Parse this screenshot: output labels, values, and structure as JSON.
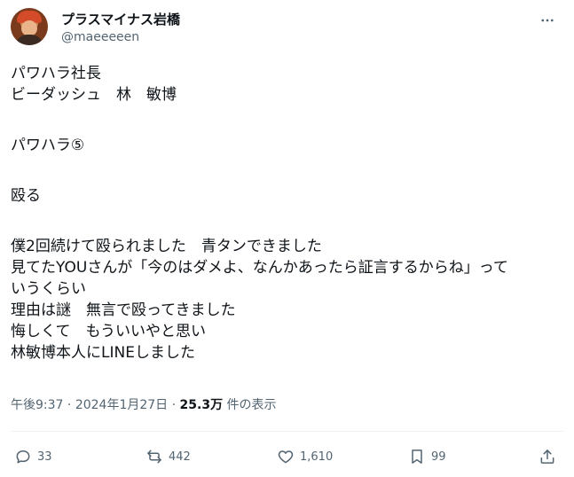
{
  "user": {
    "display_name": "プラスマイナス岩橋",
    "handle": "@maeeeeen"
  },
  "tweet": {
    "lines": [
      "パワハラ社長",
      "ビーダッシュ　林　敏博",
      "",
      "パワハラ⑤",
      "",
      "殴る",
      "",
      "僕2回続けて殴られました　青タンできました",
      "見てたYOUさんが「今のはダメよ、なんかあったら証言するからね」って",
      "いうくらい",
      "理由は謎　無言で殴ってきました",
      "悔しくて　もういいやと思い",
      "林敏博本人にLINEしました"
    ]
  },
  "meta": {
    "time": "午後9:37",
    "separator": "·",
    "date": "2024年1月27日",
    "views_count": "25.3万",
    "views_label": "件の表示"
  },
  "actions": {
    "reply_count": "33",
    "retweet_count": "442",
    "like_count": "1,610",
    "bookmark_count": "99",
    "share_count": ""
  },
  "icons": {
    "more": "more-horizontal-icon",
    "reply": "reply-icon",
    "retweet": "retweet-icon",
    "like": "heart-icon",
    "bookmark": "bookmark-icon",
    "share": "share-icon"
  }
}
